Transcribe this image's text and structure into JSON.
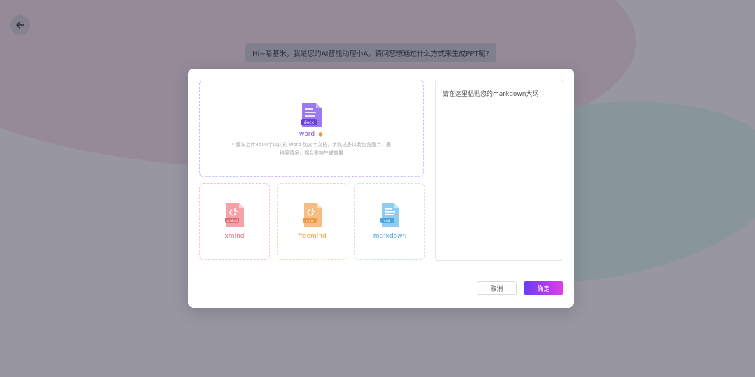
{
  "greeting": "Hi~哈基米，我是您的AI智能助理小A，请问您想通过什么方式来生成PPT呢?",
  "upload": {
    "word": {
      "label": "word",
      "badge": "docx",
      "hint": "* 建议上传4500字以内的 word 纯文字文档，字数过多以及包含图片、表格等情况，都会影响生成效果"
    },
    "cards": [
      {
        "label": "xmind",
        "badge": "xmind"
      },
      {
        "label": "freemind",
        "badge": "mm"
      },
      {
        "label": "markdown",
        "badge": "md"
      }
    ]
  },
  "markdown_pane": {
    "placeholder": "请在这里粘贴您的markdown大纲"
  },
  "footer": {
    "cancel_label": "取消",
    "confirm_label": "确定"
  },
  "colors": {
    "accent_purple": "#7b4fe0",
    "xmind_red": "#e06c74",
    "freemind_orange": "#ef9b44",
    "markdown_blue": "#4aa6dc"
  }
}
